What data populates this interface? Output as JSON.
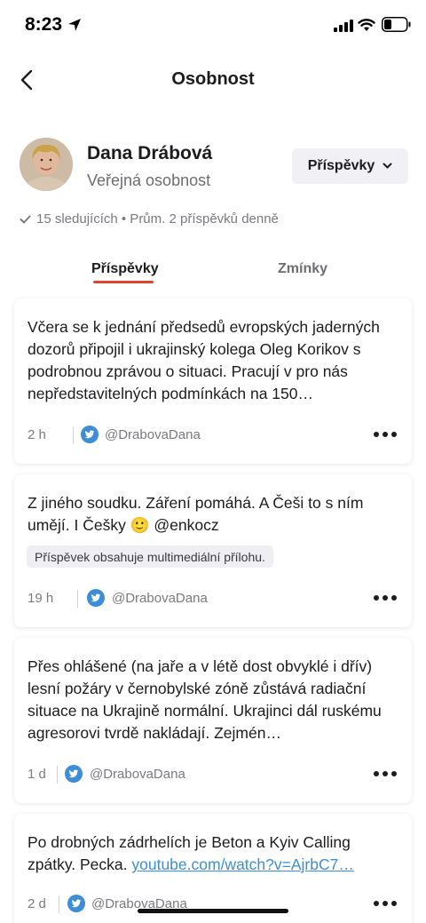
{
  "status_bar": {
    "time": "8:23"
  },
  "header": {
    "title": "Osobnost"
  },
  "profile": {
    "name": "Dana Drábová",
    "role": "Veřejná osobnost",
    "filter_label": "Příspěvky",
    "stats": "15 sledujících • Prům. 2 příspěvků denně"
  },
  "tabs": [
    {
      "label": "Příspěvky",
      "active": true
    },
    {
      "label": "Zmínky",
      "active": false
    }
  ],
  "posts": [
    {
      "text": "Včera se k jednání předsedů evropských jaderných dozorů připojil i ukrajinský kolega Oleg Korikov s podrobnou zprávou o situaci. Pracují v pro nás nepředstavitelných podmínkách na 150…",
      "time": "2 h",
      "handle": "@DrabovaDana"
    },
    {
      "text": "Z jiného soudku. Záření pomáhá. A Češi to s ním umějí. I Češky 🙂 @enkocz",
      "badge": "Příspěvek obsahuje multimediální přílohu.",
      "time": "19 h",
      "handle": "@DrabovaDana"
    },
    {
      "text": "Přes ohlášené (na jaře a v létě dost obvyklé i dřív) lesní požáry v černobylské zóně zůstává radiační situace na Ukrajině normální.  Ukrajinci dál ruskému agresorovi tvrdě nakládají. Zejmén…",
      "time": "1 d",
      "handle": "@DrabovaDana"
    },
    {
      "text_before_link": "Po drobných zádrhelích je Beton a Kyiv Calling zpátky. Pecka. ",
      "link": "youtube.com/watch?v=AjrbC7…",
      "time": "2 d",
      "handle": "@DrabovaDana"
    }
  ],
  "colors": {
    "accent": "#e0452e",
    "twitter": "#3d8ed6",
    "muted_text": "#7a7a80"
  },
  "icons": [
    "location-arrow-icon",
    "signal-icon",
    "wifi-icon",
    "battery-icon",
    "back-chevron-icon",
    "chevron-down-icon",
    "check-icon",
    "twitter-icon",
    "more-icon"
  ]
}
